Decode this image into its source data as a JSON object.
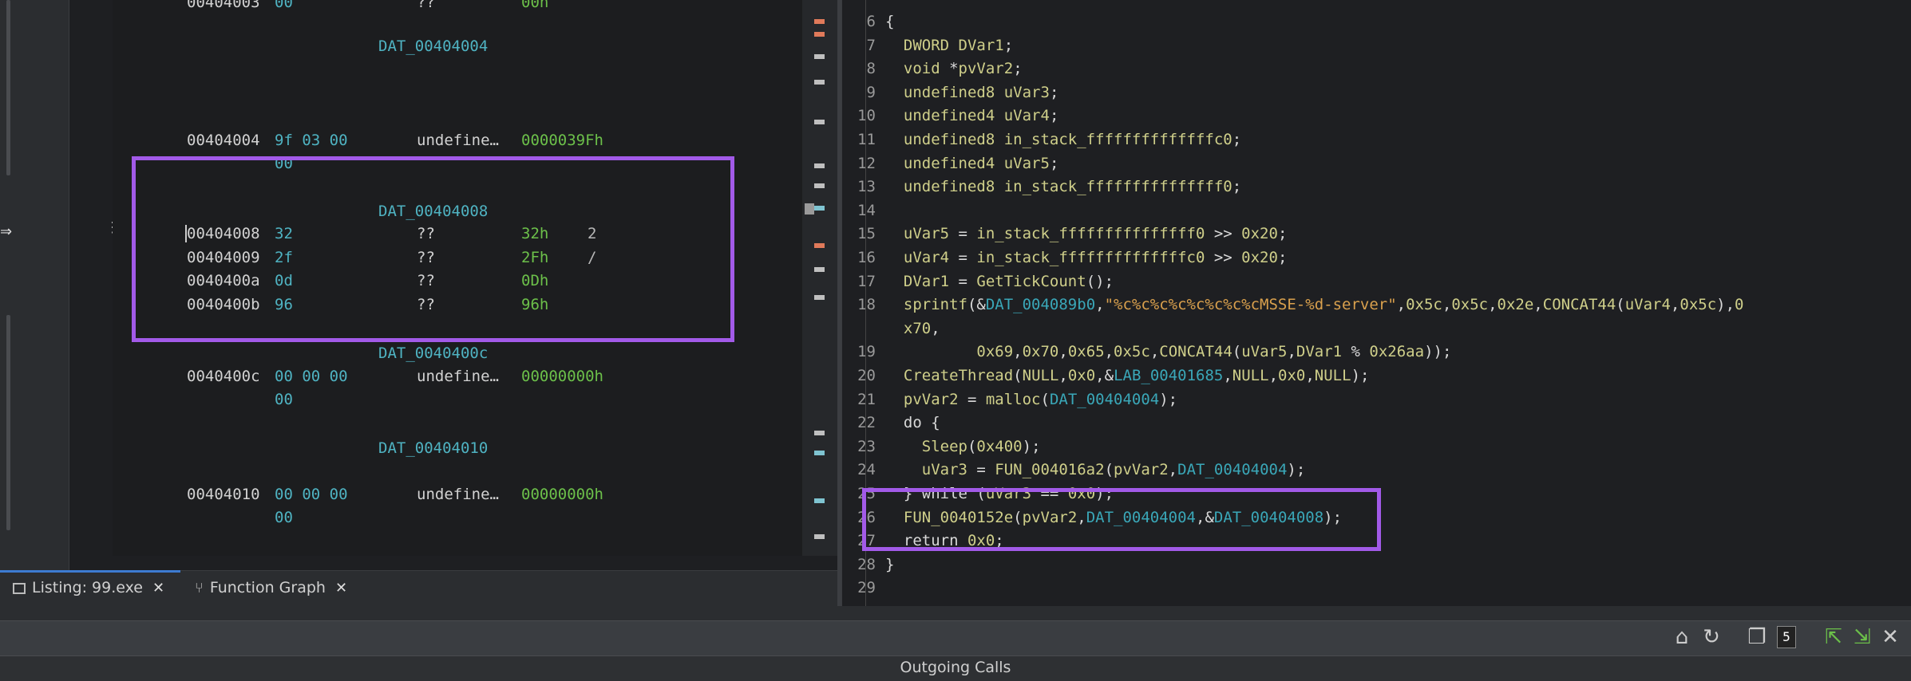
{
  "listing": {
    "rows": [
      {
        "kind": "data",
        "addr": "00404003",
        "bytes": "00",
        "mnem": "??",
        "oper": "00h",
        "cmt": ""
      },
      {
        "kind": "label",
        "text": "DAT_00404004"
      },
      {
        "kind": "data",
        "addr": "00404004",
        "bytes": "9f 03 00",
        "mnem": "undefine…",
        "oper": "0000039Fh",
        "cmt": ""
      },
      {
        "kind": "cont",
        "bytes": "00"
      },
      {
        "kind": "label",
        "text": "DAT_00404008"
      },
      {
        "kind": "data",
        "addr": "00404008",
        "bytes": "32",
        "mnem": "??",
        "oper": "32h",
        "cmt": "2"
      },
      {
        "kind": "data",
        "addr": "00404009",
        "bytes": "2f",
        "mnem": "??",
        "oper": "2Fh",
        "cmt": "/"
      },
      {
        "kind": "data",
        "addr": "0040400a",
        "bytes": "0d",
        "mnem": "??",
        "oper": "0Dh",
        "cmt": ""
      },
      {
        "kind": "data",
        "addr": "0040400b",
        "bytes": "96",
        "mnem": "??",
        "oper": "96h",
        "cmt": ""
      },
      {
        "kind": "label",
        "text": "DAT_0040400c"
      },
      {
        "kind": "data",
        "addr": "0040400c",
        "bytes": "00 00 00",
        "mnem": "undefine…",
        "oper": "00000000h",
        "cmt": ""
      },
      {
        "kind": "cont",
        "bytes": "00"
      },
      {
        "kind": "label",
        "text": "DAT_00404010"
      },
      {
        "kind": "data",
        "addr": "00404010",
        "bytes": "00 00 00",
        "mnem": "undefine…",
        "oper": "00000000h",
        "cmt": ""
      },
      {
        "kind": "cont",
        "bytes": "00"
      }
    ]
  },
  "decompiler": {
    "lines": [
      {
        "n": "6",
        "parts": [
          [
            "p",
            "{"
          ]
        ]
      },
      {
        "n": "7",
        "parts": [
          [
            "p",
            "  "
          ],
          [
            "ty",
            "DWORD"
          ],
          [
            "p",
            " "
          ],
          [
            "vr",
            "DVar1"
          ],
          [
            "p",
            ";"
          ]
        ]
      },
      {
        "n": "8",
        "parts": [
          [
            "p",
            "  "
          ],
          [
            "ty",
            "void"
          ],
          [
            "p",
            " *"
          ],
          [
            "vr",
            "pvVar2"
          ],
          [
            "p",
            ";"
          ]
        ]
      },
      {
        "n": "9",
        "parts": [
          [
            "p",
            "  "
          ],
          [
            "ty",
            "undefined8"
          ],
          [
            "p",
            " "
          ],
          [
            "vr",
            "uVar3"
          ],
          [
            "p",
            ";"
          ]
        ]
      },
      {
        "n": "10",
        "parts": [
          [
            "p",
            "  "
          ],
          [
            "ty",
            "undefined4"
          ],
          [
            "p",
            " "
          ],
          [
            "vr",
            "uVar4"
          ],
          [
            "p",
            ";"
          ]
        ]
      },
      {
        "n": "11",
        "parts": [
          [
            "p",
            "  "
          ],
          [
            "ty",
            "undefined8"
          ],
          [
            "p",
            " "
          ],
          [
            "vr",
            "in_stack_ffffffffffffffc0"
          ],
          [
            "p",
            ";"
          ]
        ]
      },
      {
        "n": "12",
        "parts": [
          [
            "p",
            "  "
          ],
          [
            "ty",
            "undefined4"
          ],
          [
            "p",
            " "
          ],
          [
            "vr",
            "uVar5"
          ],
          [
            "p",
            ";"
          ]
        ]
      },
      {
        "n": "13",
        "parts": [
          [
            "p",
            "  "
          ],
          [
            "ty",
            "undefined8"
          ],
          [
            "p",
            " "
          ],
          [
            "vr",
            "in_stack_fffffffffffffff0"
          ],
          [
            "p",
            ";"
          ]
        ]
      },
      {
        "n": "14",
        "parts": []
      },
      {
        "n": "15",
        "parts": [
          [
            "p",
            "  "
          ],
          [
            "vr",
            "uVar5"
          ],
          [
            "p",
            " = "
          ],
          [
            "vr",
            "in_stack_fffffffffffffff0"
          ],
          [
            "p",
            " >> "
          ],
          [
            "nm",
            "0x20"
          ],
          [
            "p",
            ";"
          ]
        ]
      },
      {
        "n": "16",
        "parts": [
          [
            "p",
            "  "
          ],
          [
            "vr",
            "uVar4"
          ],
          [
            "p",
            " = "
          ],
          [
            "vr",
            "in_stack_ffffffffffffffc0"
          ],
          [
            "p",
            " >> "
          ],
          [
            "nm",
            "0x20"
          ],
          [
            "p",
            ";"
          ]
        ]
      },
      {
        "n": "17",
        "parts": [
          [
            "p",
            "  "
          ],
          [
            "vr",
            "DVar1"
          ],
          [
            "p",
            " = "
          ],
          [
            "nm",
            "GetTickCount"
          ],
          [
            "p",
            "();"
          ]
        ]
      },
      {
        "n": "18",
        "parts": [
          [
            "p",
            "  "
          ],
          [
            "nm",
            "sprintf"
          ],
          [
            "p",
            "(&"
          ],
          [
            "gl",
            "DAT_004089b0"
          ],
          [
            "p",
            ","
          ],
          [
            "st",
            "\"%c%c%c%c%c%c%c%cMSSE-%d-server\""
          ],
          [
            "p",
            ","
          ],
          [
            "nm",
            "0x5c"
          ],
          [
            "p",
            ","
          ],
          [
            "nm",
            "0x5c"
          ],
          [
            "p",
            ","
          ],
          [
            "nm",
            "0x2e"
          ],
          [
            "p",
            ","
          ],
          [
            "nm",
            "CONCAT44"
          ],
          [
            "p",
            "("
          ],
          [
            "vr",
            "uVar4"
          ],
          [
            "p",
            ","
          ],
          [
            "nm",
            "0x5c"
          ],
          [
            "p",
            "),"
          ],
          [
            "nm",
            "0"
          ]
        ]
      },
      {
        "n": "",
        "parts": [
          [
            "p",
            "  "
          ],
          [
            "nm",
            "x70"
          ],
          [
            "p",
            ","
          ]
        ]
      },
      {
        "n": "19",
        "parts": [
          [
            "p",
            "          "
          ],
          [
            "nm",
            "0x69"
          ],
          [
            "p",
            ","
          ],
          [
            "nm",
            "0x70"
          ],
          [
            "p",
            ","
          ],
          [
            "nm",
            "0x65"
          ],
          [
            "p",
            ","
          ],
          [
            "nm",
            "0x5c"
          ],
          [
            "p",
            ","
          ],
          [
            "nm",
            "CONCAT44"
          ],
          [
            "p",
            "("
          ],
          [
            "vr",
            "uVar5"
          ],
          [
            "p",
            ","
          ],
          [
            "vr",
            "DVar1"
          ],
          [
            "p",
            " % "
          ],
          [
            "nm",
            "0x26aa"
          ],
          [
            "p",
            "));"
          ]
        ]
      },
      {
        "n": "20",
        "parts": [
          [
            "p",
            "  "
          ],
          [
            "nm",
            "CreateThread"
          ],
          [
            "p",
            "("
          ],
          [
            "nm",
            "NULL"
          ],
          [
            "p",
            ","
          ],
          [
            "nm",
            "0x0"
          ],
          [
            "p",
            ",&"
          ],
          [
            "gl",
            "LAB_00401685"
          ],
          [
            "p",
            ","
          ],
          [
            "nm",
            "NULL"
          ],
          [
            "p",
            ","
          ],
          [
            "nm",
            "0x0"
          ],
          [
            "p",
            ","
          ],
          [
            "nm",
            "NULL"
          ],
          [
            "p",
            ");"
          ]
        ]
      },
      {
        "n": "21",
        "parts": [
          [
            "p",
            "  "
          ],
          [
            "vr",
            "pvVar2"
          ],
          [
            "p",
            " = "
          ],
          [
            "nm",
            "malloc"
          ],
          [
            "p",
            "("
          ],
          [
            "gl",
            "DAT_00404004"
          ],
          [
            "p",
            ");"
          ]
        ]
      },
      {
        "n": "22",
        "parts": [
          [
            "p",
            "  do {"
          ]
        ]
      },
      {
        "n": "23",
        "parts": [
          [
            "p",
            "    "
          ],
          [
            "nm",
            "Sleep"
          ],
          [
            "p",
            "("
          ],
          [
            "nm",
            "0x400"
          ],
          [
            "p",
            ");"
          ]
        ]
      },
      {
        "n": "24",
        "parts": [
          [
            "p",
            "    "
          ],
          [
            "vr",
            "uVar3"
          ],
          [
            "p",
            " = "
          ],
          [
            "nm",
            "FUN_004016a2"
          ],
          [
            "p",
            "("
          ],
          [
            "vr",
            "pvVar2"
          ],
          [
            "p",
            ","
          ],
          [
            "gl",
            "DAT_00404004"
          ],
          [
            "p",
            ");"
          ]
        ]
      },
      {
        "n": "25",
        "parts": [
          [
            "p",
            "  } while ("
          ],
          [
            "vr",
            "uVar3"
          ],
          [
            "p",
            " == "
          ],
          [
            "nm",
            "0x0"
          ],
          [
            "p",
            ");"
          ]
        ]
      },
      {
        "n": "26",
        "parts": [
          [
            "p",
            "  "
          ],
          [
            "nm",
            "FUN_0040152e"
          ],
          [
            "p",
            "("
          ],
          [
            "vr",
            "pvVar2"
          ],
          [
            "p",
            ","
          ],
          [
            "gl",
            "DAT_00404004"
          ],
          [
            "p",
            ",&"
          ],
          [
            "gl",
            "DAT_00404008"
          ],
          [
            "p",
            ");"
          ]
        ]
      },
      {
        "n": "27",
        "parts": [
          [
            "p",
            "  return "
          ],
          [
            "nm",
            "0x0"
          ],
          [
            "p",
            ";"
          ]
        ]
      },
      {
        "n": "28",
        "parts": [
          [
            "p",
            "}"
          ]
        ]
      },
      {
        "n": "29",
        "parts": []
      }
    ]
  },
  "tabs": [
    {
      "label": "Listing:  99.exe",
      "icon": "listing-icon",
      "active": true
    },
    {
      "label": "Function Graph",
      "icon": "function-graph-icon",
      "active": false
    }
  ],
  "lower_panel": {
    "title": "Outgoing Calls",
    "badge": "5"
  },
  "colors": {
    "annotation": "#a25ae8"
  }
}
